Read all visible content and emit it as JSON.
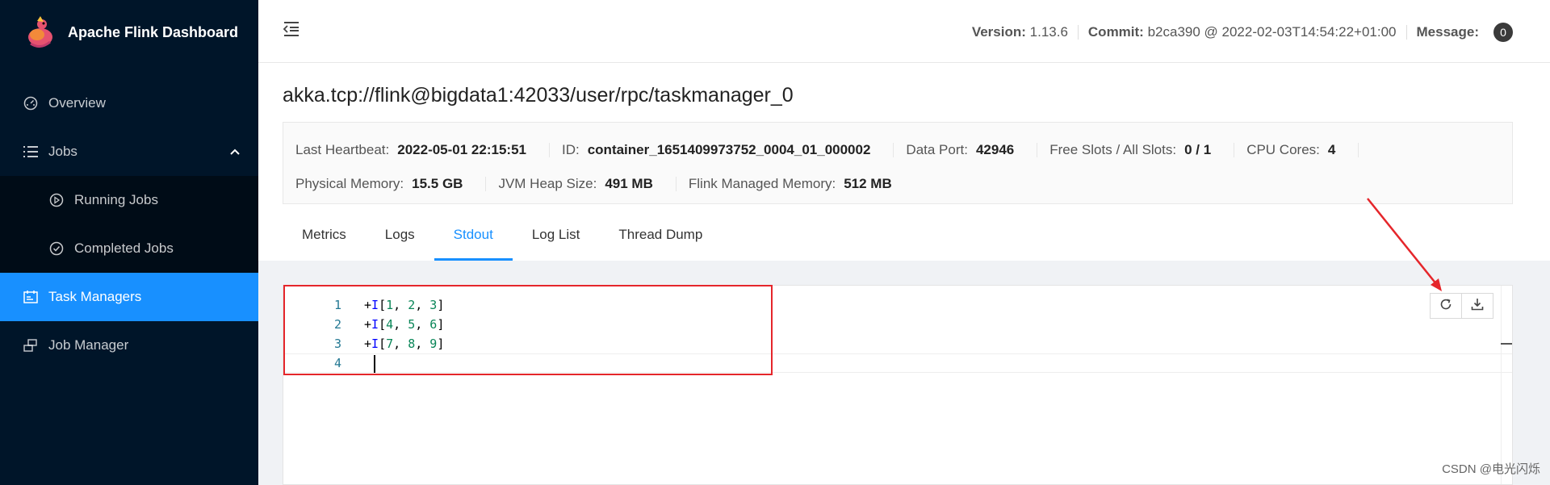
{
  "sidebar": {
    "title": "Apache Flink Dashboard",
    "items": [
      {
        "label": "Overview",
        "icon": "dashboard-icon"
      },
      {
        "label": "Jobs",
        "icon": "list-icon"
      },
      {
        "label": "Running Jobs",
        "icon": "play-circle-icon"
      },
      {
        "label": "Completed Jobs",
        "icon": "check-circle-icon"
      },
      {
        "label": "Task Managers",
        "icon": "schedule-icon"
      },
      {
        "label": "Job Manager",
        "icon": "cluster-icon"
      }
    ]
  },
  "header": {
    "version_label": "Version:",
    "version_value": "1.13.6",
    "commit_label": "Commit:",
    "commit_value": "b2ca390 @ 2022-02-03T14:54:22+01:00",
    "message_label": "Message:",
    "message_count": "0"
  },
  "page": {
    "title": "akka.tcp://flink@bigdata1:42033/user/rpc/taskmanager_0"
  },
  "details": {
    "row1": [
      {
        "label": "Last Heartbeat:",
        "value": "2022-05-01 22:15:51"
      },
      {
        "label": "ID:",
        "value": "container_1651409973752_0004_01_000002"
      },
      {
        "label": "Data Port:",
        "value": "42946"
      },
      {
        "label": "Free Slots / All Slots:",
        "value": "0 / 1"
      },
      {
        "label": "CPU Cores:",
        "value": "4"
      }
    ],
    "row2": [
      {
        "label": "Physical Memory:",
        "value": "15.5 GB"
      },
      {
        "label": "JVM Heap Size:",
        "value": "491 MB"
      },
      {
        "label": "Flink Managed Memory:",
        "value": "512 MB"
      }
    ]
  },
  "tabs": [
    "Metrics",
    "Logs",
    "Stdout",
    "Log List",
    "Thread Dump"
  ],
  "active_tab": "Stdout",
  "editor": {
    "lines": [
      {
        "no": "1",
        "prefix": "+",
        "kind": "I",
        "open": "[",
        "a": "1",
        "b": "2",
        "c": "3",
        "close": "]"
      },
      {
        "no": "2",
        "prefix": "+",
        "kind": "I",
        "open": "[",
        "a": "4",
        "b": "5",
        "c": "6",
        "close": "]"
      },
      {
        "no": "3",
        "prefix": "+",
        "kind": "I",
        "open": "[",
        "a": "7",
        "b": "8",
        "c": "9",
        "close": "]"
      },
      {
        "no": "4"
      }
    ]
  },
  "watermark": "CSDN @电光闪烁",
  "colors": {
    "sidebar_bg": "#001529",
    "accent": "#1890ff",
    "annotation": "#e5262b"
  }
}
